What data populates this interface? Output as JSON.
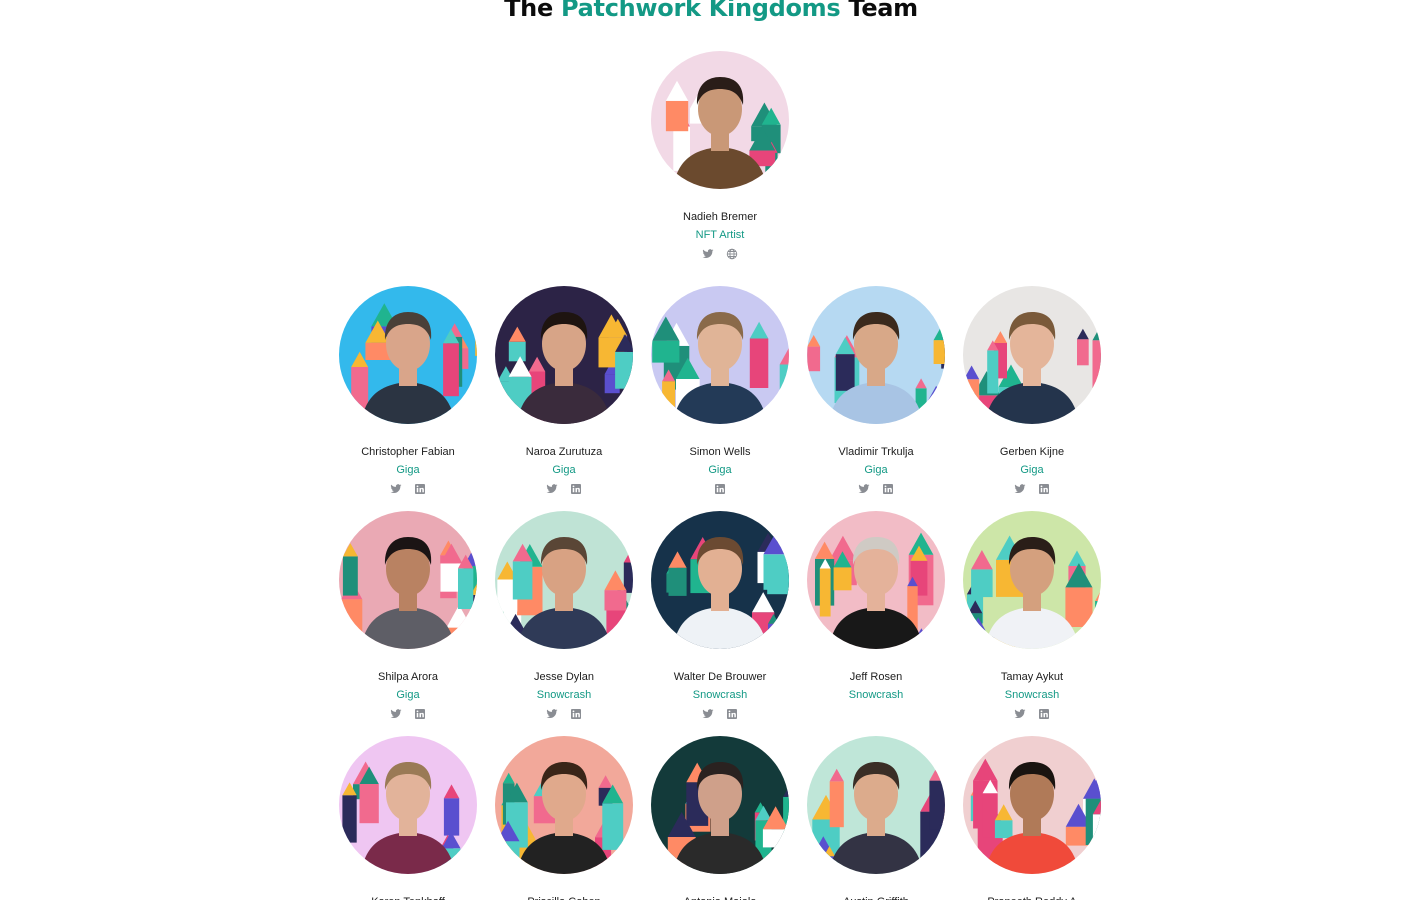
{
  "heading": {
    "prefix": "The ",
    "accent": "Patchwork Kingdoms",
    "suffix": " Team"
  },
  "featured": {
    "name": "Nadieh Bremer",
    "role": "NFT Artist",
    "links": [
      "twitter",
      "website"
    ],
    "bg": "#f2d9e6",
    "skin": "#c99877",
    "hair": "#2a1d18",
    "shirt": "#6b4a2e"
  },
  "rows": [
    [
      {
        "name": "Christopher Fabian",
        "role": "Giga",
        "links": [
          "twitter",
          "linkedin"
        ],
        "bg": "#33b9ec",
        "skin": "#d9a58a",
        "hair": "#4a4038",
        "shirt": "#2b3442"
      },
      {
        "name": "Naroa Zurutuza",
        "role": "Giga",
        "links": [
          "twitter",
          "linkedin"
        ],
        "bg": "#2c2346",
        "skin": "#d7a487",
        "hair": "#1e1410",
        "shirt": "#3a2b3c"
      },
      {
        "name": "Simon Wells",
        "role": "Giga",
        "links": [
          "linkedin"
        ],
        "bg": "#c9c9f2",
        "skin": "#e0b497",
        "hair": "#8a6a4a",
        "shirt": "#233a57"
      },
      {
        "name": "Vladimir Trkulja",
        "role": "Giga",
        "links": [
          "twitter",
          "linkedin"
        ],
        "bg": "#b6d9f2",
        "skin": "#d8a888",
        "hair": "#3b2a1d",
        "shirt": "#a8c4e4"
      },
      {
        "name": "Gerben Kijne",
        "role": "Giga",
        "links": [
          "twitter",
          "linkedin"
        ],
        "bg": "#e8e6e4",
        "skin": "#e4b59a",
        "hair": "#7a5a3a",
        "shirt": "#24344c"
      }
    ],
    [
      {
        "name": "Shilpa Arora",
        "role": "Giga",
        "links": [
          "twitter",
          "linkedin"
        ],
        "bg": "#eaa9b4",
        "skin": "#b98262",
        "hair": "#1b1414",
        "shirt": "#5e5e66"
      },
      {
        "name": "Jesse Dylan",
        "role": "Snowcrash",
        "links": [
          "twitter",
          "linkedin"
        ],
        "bg": "#bfe3d5",
        "skin": "#d8a283",
        "hair": "#5a4636",
        "shirt": "#2f3a57"
      },
      {
        "name": "Walter De Brouwer",
        "role": "Snowcrash",
        "links": [
          "twitter",
          "linkedin"
        ],
        "bg": "#16324a",
        "skin": "#e2b093",
        "hair": "#6b4a32",
        "shirt": "#eef2f6"
      },
      {
        "name": "Jeff Rosen",
        "role": "Snowcrash",
        "links": [],
        "bg": "#f2bcc6",
        "skin": "#e4b29a",
        "hair": "#cfcac4",
        "shirt": "#181818"
      },
      {
        "name": "Tamay Aykut",
        "role": "Snowcrash",
        "links": [
          "twitter",
          "linkedin"
        ],
        "bg": "#cde6a8",
        "skin": "#d4a07e",
        "hair": "#2a1e18",
        "shirt": "#f0f2f6"
      }
    ],
    [
      {
        "name": "Karen Tenkhoff",
        "role": "",
        "links": [],
        "bg": "#efc6f2",
        "skin": "#e2b39a",
        "hair": "#9a7a56",
        "shirt": "#7a2a4a"
      },
      {
        "name": "Priscilla Cohen",
        "role": "",
        "links": [],
        "bg": "#f2a89a",
        "skin": "#e0a98c",
        "hair": "#3a2518",
        "shirt": "#222222"
      },
      {
        "name": "Antonio Maiolo",
        "role": "",
        "links": [],
        "bg": "#133a3a",
        "skin": "#cfa08a",
        "hair": "#2a2220",
        "shirt": "#2a2a2a"
      },
      {
        "name": "Austin Griffith",
        "role": "",
        "links": [],
        "bg": "#bfe6d8",
        "skin": "#dcab8c",
        "hair": "#3a2e26",
        "shirt": "#334"
      },
      {
        "name": "Praneeth Reddy A",
        "role": "",
        "links": [],
        "bg": "#f0cfd0",
        "skin": "#b07a58",
        "hair": "#1a1410",
        "shirt": "#f04a3a"
      }
    ]
  ],
  "colors": {
    "accent": "#139985",
    "icon": "#8a8d93"
  }
}
